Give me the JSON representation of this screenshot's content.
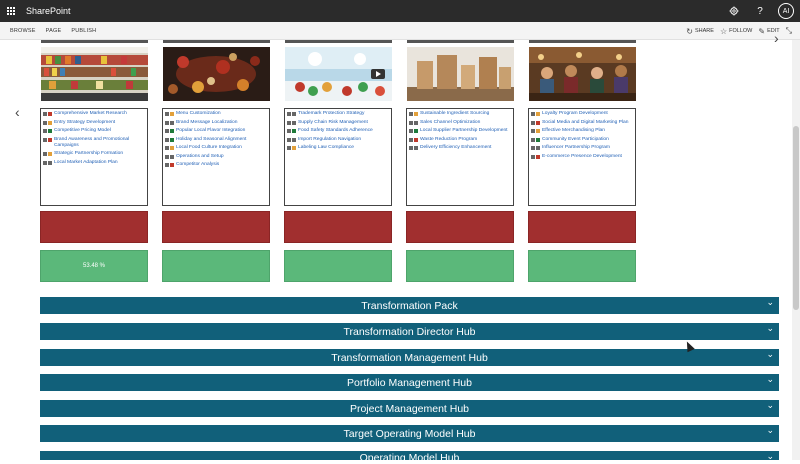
{
  "topbar": {
    "app_title": "SharePoint",
    "avatar_initials": "AI"
  },
  "ribbon": {
    "tabs": [
      "BROWSE",
      "PAGE",
      "PUBLISH"
    ],
    "actions": [
      "SHARE",
      "FOLLOW",
      "EDIT"
    ]
  },
  "cards": [
    {
      "image_theme": "supermarket aisle",
      "items": [
        {
          "label": "Comprehensive Market Research",
          "color": "#c0392b"
        },
        {
          "label": "Entry Strategy Development",
          "color": "#e2a03a"
        },
        {
          "label": "Competitive Pricing Model",
          "color": "#1f7a3a"
        },
        {
          "label": "Brand Awareness and Promotional Campaigns",
          "color": "#c0392b"
        },
        {
          "label": "Strategic Partnership Formation",
          "color": "#e2a03a"
        },
        {
          "label": "Local Market Adaptation Plan",
          "color": "#666666"
        }
      ],
      "progress_text": "53.48 %"
    },
    {
      "image_theme": "spice map",
      "items": [
        {
          "label": "Menu Customization",
          "color": "#e2a03a"
        },
        {
          "label": "Brand Message Localization",
          "color": "#666666"
        },
        {
          "label": "Popular Local Flavor Integration",
          "color": "#1f7a3a"
        },
        {
          "label": "Holiday and Seasonal Alignment",
          "color": "#1f7a3a"
        },
        {
          "label": "Local Food Culture Integration",
          "color": "#e2a03a"
        },
        {
          "label": "Operations and Setup",
          "color": "#666666"
        },
        {
          "label": "Competitor Analysis",
          "color": "#c0392b"
        }
      ],
      "progress_text": ""
    },
    {
      "image_theme": "food lab",
      "items": [
        {
          "label": "Trademark Protection Strategy",
          "color": "#666666"
        },
        {
          "label": "Supply Chain Risk Management",
          "color": "#666666"
        },
        {
          "label": "Food Safety Standards Adherence",
          "color": "#1f7a3a"
        },
        {
          "label": "Import Regulation Navigation",
          "color": "#666666"
        },
        {
          "label": "Labeling Law Compliance",
          "color": "#e2a03a"
        }
      ],
      "progress_text": ""
    },
    {
      "image_theme": "paper bags",
      "items": [
        {
          "label": "Sustainable Ingredient Sourcing",
          "color": "#e2a03a"
        },
        {
          "label": "Sales Channel Optimization",
          "color": "#666666"
        },
        {
          "label": "Local Supplier Partnership Development",
          "color": "#1f7a3a"
        },
        {
          "label": "Waste Reduction Program",
          "color": "#c0392b"
        },
        {
          "label": "Delivery Efficiency Enhancement",
          "color": "#666666"
        }
      ],
      "progress_text": ""
    },
    {
      "image_theme": "cafe crowd",
      "items": [
        {
          "label": "Loyalty Program Development",
          "color": "#e2a03a"
        },
        {
          "label": "Social Media and Digital Marketing Plan",
          "color": "#c0392b"
        },
        {
          "label": "Effective Merchandising Plan",
          "color": "#e2a03a"
        },
        {
          "label": "Community Event Participation",
          "color": "#1f7a3a"
        },
        {
          "label": "Influencer Partnership Program",
          "color": "#666666"
        },
        {
          "label": "E-commerce Presence Development",
          "color": "#c0392b"
        }
      ],
      "progress_text": ""
    }
  ],
  "hubs": [
    "Transformation Pack",
    "Transformation Director Hub",
    "Transformation Management Hub",
    "Portfolio Management Hub",
    "Project Management Hub",
    "Target Operating Model Hub",
    "Operating Model Hub"
  ],
  "icons": {
    "app_launcher": "waffle-icon",
    "settings": "gear-icon",
    "help": "question-icon",
    "prev": "chevron-left-icon",
    "next": "chevron-right-icon",
    "expand": "chevron-down-icon"
  }
}
